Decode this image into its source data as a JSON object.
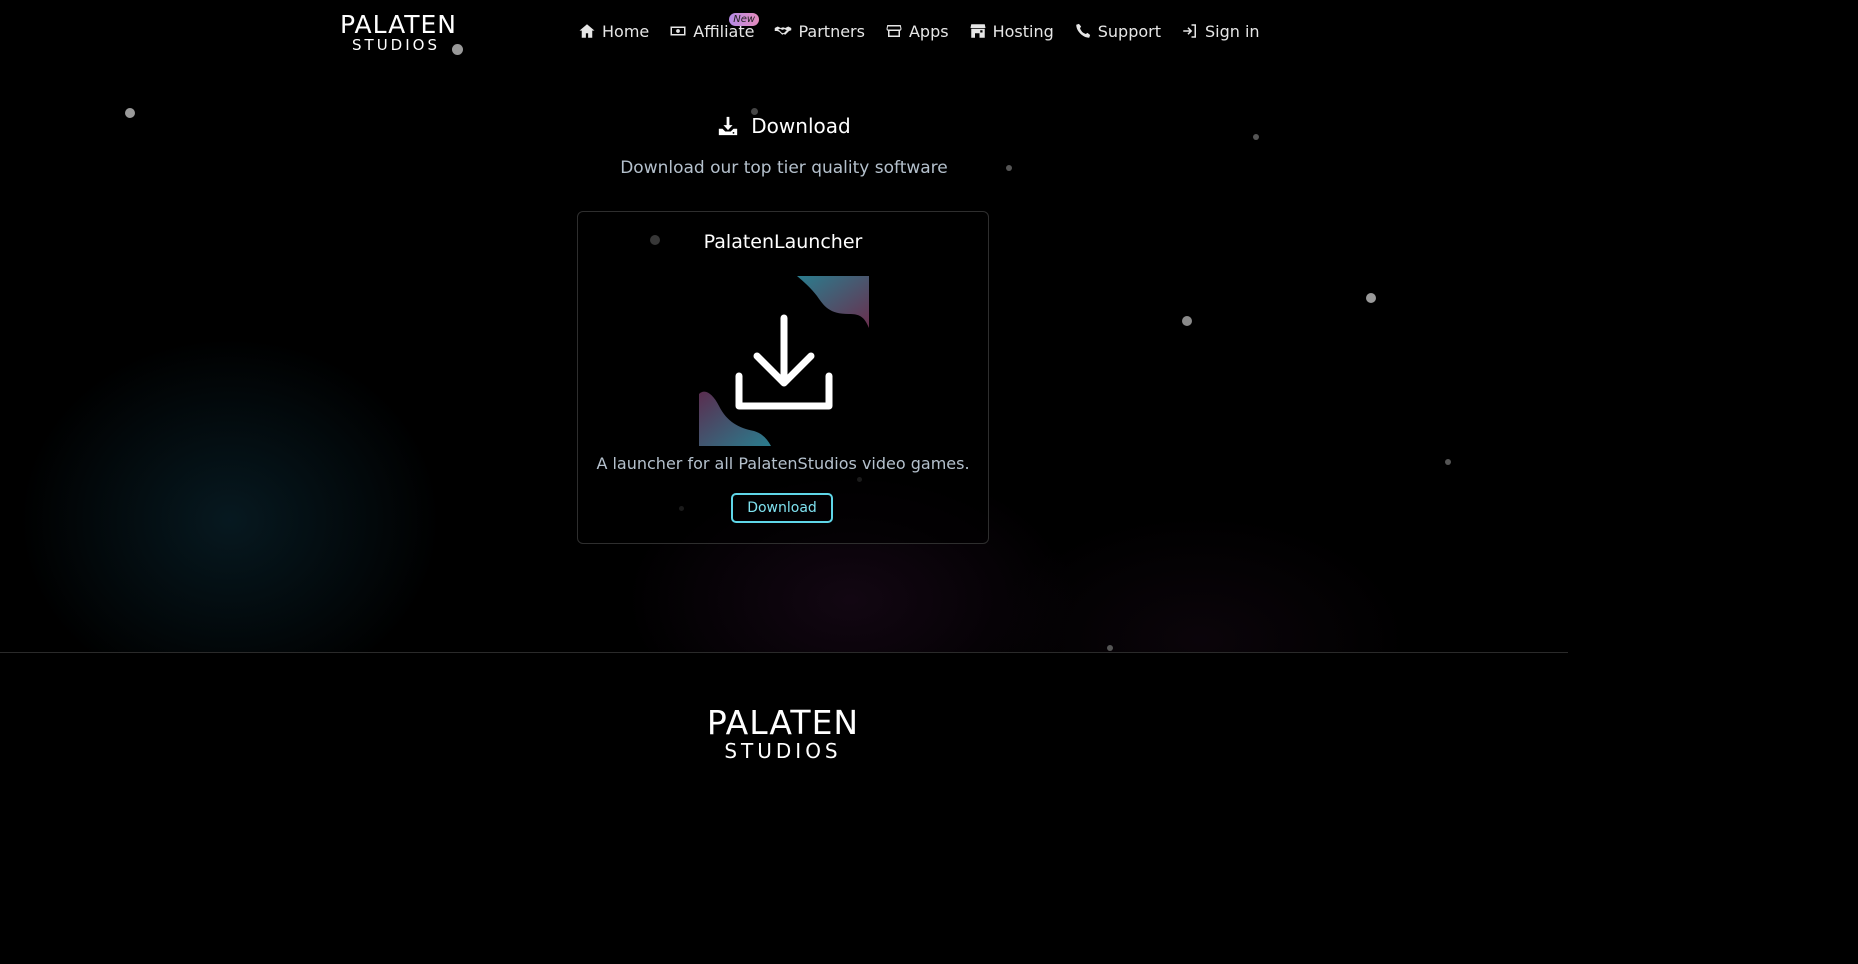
{
  "brand": {
    "logo_line1": "PALATEN",
    "logo_line2": "STUDIOS"
  },
  "nav": {
    "items": [
      {
        "label": "Home",
        "icon": "home-icon"
      },
      {
        "label": "Affiliate",
        "icon": "money-icon",
        "badge": "New"
      },
      {
        "label": "Partners",
        "icon": "handshake-icon"
      },
      {
        "label": "Apps",
        "icon": "store-icon"
      },
      {
        "label": "Hosting",
        "icon": "shop-icon"
      },
      {
        "label": "Support",
        "icon": "phone-icon"
      },
      {
        "label": "Sign in",
        "icon": "sign-in-icon"
      }
    ]
  },
  "section": {
    "title": "Download",
    "title_icon": "download-icon",
    "subtitle": "Download our top tier quality software"
  },
  "card": {
    "title": "PalatenLauncher",
    "image_icon": "download-arrow-icon",
    "description": "A launcher for all PalatenStudios video games.",
    "button_label": "Download"
  },
  "footer": {
    "logo_line1": "PALATEN",
    "logo_line2": "STUDIOS"
  },
  "colors": {
    "background": "#000000",
    "accent": "#5fd6e8",
    "text_muted": "#b4c0cc",
    "badge_gradient_start": "#b58be6",
    "badge_gradient_end": "#e48bbd"
  }
}
